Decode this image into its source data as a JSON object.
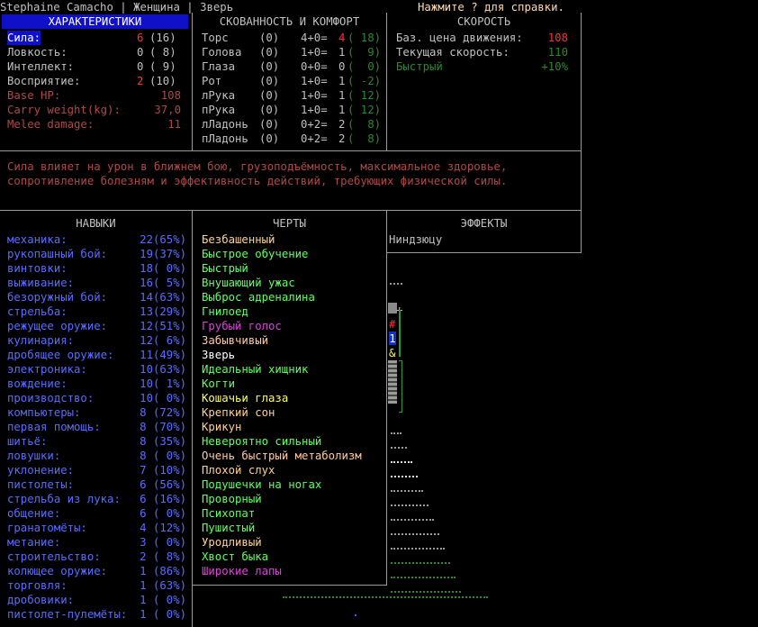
{
  "title": {
    "name": "Stephaine Camacho | Женщина | Зверь",
    "help": "Нажмите ? для справки."
  },
  "stats": {
    "header": "ХАРАКТЕРИСТИКИ",
    "rows": [
      {
        "label": "Сила:",
        "val": "6",
        "base": "(16)",
        "hl": true,
        "lc": "c-white",
        "vc": "c-red"
      },
      {
        "label": "Ловкость:",
        "val": "0",
        "base": "( 8)",
        "lc": "c-def",
        "vc": "c-def"
      },
      {
        "label": "Интеллект:",
        "val": "0",
        "base": "( 9)",
        "lc": "c-def",
        "vc": "c-def"
      },
      {
        "label": "Восприятие:",
        "val": "2",
        "base": "(10)",
        "lc": "c-def",
        "vc": "c-red"
      }
    ],
    "derived": [
      {
        "label": "Base HP:",
        "val": "108"
      },
      {
        "label": "Carry weight(kg):",
        "val": "37,0"
      },
      {
        "label": "Melee damage:",
        "val": "11"
      }
    ]
  },
  "encumbrance": {
    "header": "СКОВАННОСТЬ И КОМФОРТ",
    "rows": [
      {
        "part": "Торс",
        "a": "(0)",
        "f": "4+0=",
        "r": "4",
        "rc": "c-red",
        "w": "( 18)"
      },
      {
        "part": "Голова",
        "a": "(0)",
        "f": "1+0=",
        "r": "1",
        "rc": "c-def",
        "w": "(  9)"
      },
      {
        "part": "Глаза",
        "a": "(0)",
        "f": "0+0=",
        "r": "0",
        "rc": "c-def",
        "w": "(  0)"
      },
      {
        "part": "Рот",
        "a": "(0)",
        "f": "1+0=",
        "r": "1",
        "rc": "c-def",
        "w": "( -2)"
      },
      {
        "part": "лРука",
        "a": "(0)",
        "f": "1+0=",
        "r": "1",
        "rc": "c-def",
        "w": "( 12)"
      },
      {
        "part": "пРука",
        "a": "(0)",
        "f": "1+0=",
        "r": "1",
        "rc": "c-def",
        "w": "( 12)"
      },
      {
        "part": "лЛадонь",
        "a": "(0)",
        "f": "0+2=",
        "r": "2",
        "rc": "c-def",
        "w": "(  8)"
      },
      {
        "part": "пЛадонь",
        "a": "(0)",
        "f": "0+2=",
        "r": "2",
        "rc": "c-def",
        "w": "(  8)"
      }
    ]
  },
  "speed": {
    "header": "СКОРОСТЬ",
    "rows": [
      {
        "label": "Баз. цена движения:",
        "val": "108",
        "lc": "c-def",
        "vc": "c-red"
      },
      {
        "label": "Текущая скорость:",
        "val": "110",
        "lc": "c-def",
        "vc": "c-dgreen"
      },
      {
        "label": "Быстрый",
        "val": "+10%",
        "lc": "c-dgreen",
        "vc": "c-dgreen"
      }
    ]
  },
  "description": "Сила влияет на урон в ближнем бою, грузоподъёмность, максимальное здоровье,\nсопротивление болезням и эффективность действий, требующих физической силы.",
  "skills": {
    "header": "НАВЫКИ",
    "rows": [
      [
        "механика:",
        "22(65%)"
      ],
      [
        "рукопашный бой:",
        "19(37%)"
      ],
      [
        "винтовки:",
        "18( 0%)"
      ],
      [
        "выживание:",
        "16( 5%)"
      ],
      [
        "безоружный бой:",
        "14(63%)"
      ],
      [
        "стрельба:",
        "13(29%)"
      ],
      [
        "режущее оружие:",
        "12(51%)"
      ],
      [
        "кулинария:",
        "12( 6%)"
      ],
      [
        "дробящее оружие:",
        "11(49%)"
      ],
      [
        "электроника:",
        "10(63%)"
      ],
      [
        "вождение:",
        "10( 1%)"
      ],
      [
        "производство:",
        "10( 0%)"
      ],
      [
        "компьютеры:",
        "8 (72%)"
      ],
      [
        "первая помощь:",
        "8 (70%)"
      ],
      [
        "шитьё:",
        "8 (35%)"
      ],
      [
        "ловушки:",
        "8 ( 0%)"
      ],
      [
        "уклонение:",
        "7 (10%)"
      ],
      [
        "пистолеты:",
        "6 (56%)"
      ],
      [
        "стрельба из лука:",
        "6 (16%)"
      ],
      [
        "общение:",
        "6 ( 0%)"
      ],
      [
        "гранатомёты:",
        "4 (12%)"
      ],
      [
        "метание:",
        "3 ( 0%)"
      ],
      [
        "строительство:",
        "2 ( 8%)"
      ],
      [
        "колющее оружие:",
        "1 (86%)"
      ],
      [
        "торговля:",
        "1 (63%)"
      ],
      [
        "дробовики:",
        "1 ( 0%)"
      ],
      [
        "пистолет-пулемёты:",
        "1 ( 0%)"
      ]
    ]
  },
  "traits": {
    "header": "ЧЕРТЫ",
    "rows": [
      {
        "t": "Безбашенный",
        "c": "c-orange"
      },
      {
        "t": "Быстрое обучение",
        "c": "c-lgreen"
      },
      {
        "t": "Быстрый",
        "c": "c-lgreen"
      },
      {
        "t": "Внушающий ужас",
        "c": "c-lgreen"
      },
      {
        "t": "Выброс адреналина",
        "c": "c-lgreen"
      },
      {
        "t": "Гнилоед",
        "c": "c-lgreen"
      },
      {
        "t": "Грубый голос",
        "c": "c-mag"
      },
      {
        "t": "Забывчивый",
        "c": "c-peach"
      },
      {
        "t": "Зверь",
        "c": "c-white"
      },
      {
        "t": "Идеальный хищник",
        "c": "c-lgreen"
      },
      {
        "t": "Когти",
        "c": "c-lgreen"
      },
      {
        "t": "Кошачьи глаза",
        "c": "c-yellow"
      },
      {
        "t": "Крепкий сон",
        "c": "c-orange"
      },
      {
        "t": "Крикун",
        "c": "c-orange"
      },
      {
        "t": "Невероятно сильный",
        "c": "c-lgreen"
      },
      {
        "t": "Очень быстрый метаболизм",
        "c": "c-peach"
      },
      {
        "t": "Плохой слух",
        "c": "c-orange"
      },
      {
        "t": "Подушечки на ногах",
        "c": "c-lgreen"
      },
      {
        "t": "Проворный",
        "c": "c-lgreen"
      },
      {
        "t": "Психопат",
        "c": "c-lgreen"
      },
      {
        "t": "Пушистый",
        "c": "c-lgreen"
      },
      {
        "t": "Уродливый",
        "c": "c-orange"
      },
      {
        "t": "Хвост быка",
        "c": "c-lgreen"
      },
      {
        "t": "Широкие лапы",
        "c": "c-mag"
      }
    ]
  },
  "effects": {
    "header": "ЭФФЕКТЫ",
    "rows": [
      "Ниндзюцу"
    ]
  },
  "map": {
    "sym_hash": "#",
    "sym_one": "1",
    "sym_amp": "&",
    "sym_plus": "+"
  }
}
